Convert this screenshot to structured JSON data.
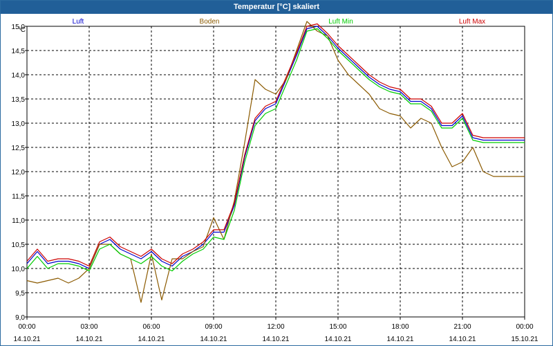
{
  "window": {
    "title": "Temperatur [°C] skaliert"
  },
  "chart_data": {
    "type": "line",
    "title": "Temperatur [°C] skaliert",
    "ylabel": "°C",
    "ylim": [
      9.0,
      15.0
    ],
    "yticks": [
      "9,0",
      "9,5",
      "10,0",
      "10,5",
      "11,0",
      "11,5",
      "12,0",
      "12,5",
      "13,0",
      "13,5",
      "14,0",
      "14,5",
      "15,0"
    ],
    "xlim": [
      0,
      24
    ],
    "xticks": [
      {
        "time": "00:00",
        "date": "14.10.21"
      },
      {
        "time": "03:00",
        "date": "14.10.21"
      },
      {
        "time": "06:00",
        "date": "14.10.21"
      },
      {
        "time": "09:00",
        "date": "14.10.21"
      },
      {
        "time": "12:00",
        "date": "14.10.21"
      },
      {
        "time": "15:00",
        "date": "14.10.21"
      },
      {
        "time": "18:00",
        "date": "14.10.21"
      },
      {
        "time": "21:00",
        "date": "14.10.21"
      },
      {
        "time": "00:00",
        "date": "15.10.21"
      }
    ],
    "grid": true,
    "legend_position": "top",
    "series": [
      {
        "name": "Luft",
        "color": "#0000cc",
        "x": [
          0,
          0.5,
          1,
          1.5,
          2,
          2.5,
          3,
          3.5,
          4,
          4.5,
          5,
          5.5,
          6,
          6.5,
          7,
          7.5,
          8,
          8.5,
          9,
          9.5,
          10,
          10.5,
          11,
          11.5,
          12,
          12.5,
          13,
          13.5,
          14,
          14.5,
          15,
          15.5,
          16,
          16.5,
          17,
          17.5,
          18,
          18.5,
          19,
          19.5,
          20,
          20.5,
          21,
          21.5,
          22,
          22.5,
          23,
          23.5,
          24
        ],
        "values": [
          10.1,
          10.35,
          10.1,
          10.15,
          10.15,
          10.1,
          10.0,
          10.5,
          10.6,
          10.4,
          10.3,
          10.2,
          10.35,
          10.15,
          10.05,
          10.25,
          10.35,
          10.5,
          10.75,
          10.75,
          11.3,
          12.3,
          13.05,
          13.3,
          13.4,
          13.9,
          14.4,
          14.95,
          15.0,
          14.8,
          14.55,
          14.35,
          14.15,
          13.95,
          13.8,
          13.7,
          13.65,
          13.45,
          13.45,
          13.3,
          12.95,
          12.95,
          13.15,
          12.7,
          12.65,
          12.65,
          12.65,
          12.65,
          12.65
        ]
      },
      {
        "name": "Boden",
        "color": "#8b5a00",
        "x": [
          0,
          0.5,
          1,
          1.5,
          2,
          2.5,
          3,
          3.5,
          4,
          4.5,
          5,
          5.5,
          6,
          6.5,
          7,
          7.5,
          8,
          8.5,
          9,
          9.5,
          10,
          10.5,
          11,
          11.5,
          12,
          12.5,
          13,
          13.5,
          14,
          14.5,
          15,
          15.5,
          16,
          16.5,
          17,
          17.5,
          18,
          18.5,
          19,
          19.5,
          20,
          20.5,
          21,
          21.5,
          22,
          22.5,
          23,
          23.5,
          24
        ],
        "values": [
          9.75,
          9.7,
          9.75,
          9.8,
          9.7,
          9.8,
          10.0,
          10.5,
          10.5,
          10.3,
          10.2,
          9.3,
          10.3,
          9.35,
          10.2,
          10.2,
          10.35,
          10.45,
          11.05,
          10.6,
          11.4,
          12.6,
          13.9,
          13.7,
          13.6,
          13.9,
          14.5,
          15.1,
          14.9,
          14.8,
          14.3,
          14.0,
          13.8,
          13.6,
          13.3,
          13.2,
          13.15,
          12.9,
          13.1,
          13.0,
          12.5,
          12.1,
          12.2,
          12.5,
          12.0,
          11.9,
          11.9,
          11.9,
          11.9
        ]
      },
      {
        "name": "Luft Min",
        "color": "#00cc00",
        "x": [
          0,
          0.5,
          1,
          1.5,
          2,
          2.5,
          3,
          3.5,
          4,
          4.5,
          5,
          5.5,
          6,
          6.5,
          7,
          7.5,
          8,
          8.5,
          9,
          9.5,
          10,
          10.5,
          11,
          11.5,
          12,
          12.5,
          13,
          13.5,
          14,
          14.5,
          15,
          15.5,
          16,
          16.5,
          17,
          17.5,
          18,
          18.5,
          19,
          19.5,
          20,
          20.5,
          21,
          21.5,
          22,
          22.5,
          23,
          23.5,
          24
        ],
        "values": [
          10.0,
          10.25,
          10.0,
          10.1,
          10.1,
          10.05,
          9.95,
          10.4,
          10.5,
          10.3,
          10.2,
          10.1,
          10.25,
          10.05,
          9.95,
          10.15,
          10.3,
          10.4,
          10.65,
          10.6,
          11.2,
          12.2,
          12.95,
          13.2,
          13.3,
          13.8,
          14.3,
          14.9,
          14.95,
          14.75,
          14.5,
          14.3,
          14.1,
          13.9,
          13.75,
          13.65,
          13.6,
          13.4,
          13.4,
          13.25,
          12.9,
          12.9,
          13.1,
          12.65,
          12.6,
          12.6,
          12.6,
          12.6,
          12.6
        ]
      },
      {
        "name": "Luft Max",
        "color": "#cc0000",
        "x": [
          0,
          0.5,
          1,
          1.5,
          2,
          2.5,
          3,
          3.5,
          4,
          4.5,
          5,
          5.5,
          6,
          6.5,
          7,
          7.5,
          8,
          8.5,
          9,
          9.5,
          10,
          10.5,
          11,
          11.5,
          12,
          12.5,
          13,
          13.5,
          14,
          14.5,
          15,
          15.5,
          16,
          16.5,
          17,
          17.5,
          18,
          18.5,
          19,
          19.5,
          20,
          20.5,
          21,
          21.5,
          22,
          22.5,
          23,
          23.5,
          24
        ],
        "values": [
          10.15,
          10.4,
          10.15,
          10.2,
          10.2,
          10.15,
          10.05,
          10.55,
          10.65,
          10.45,
          10.35,
          10.25,
          10.4,
          10.2,
          10.1,
          10.3,
          10.4,
          10.55,
          10.8,
          10.8,
          11.35,
          12.35,
          13.1,
          13.35,
          13.45,
          13.95,
          14.45,
          15.0,
          15.05,
          14.85,
          14.6,
          14.4,
          14.2,
          14.0,
          13.85,
          13.75,
          13.7,
          13.5,
          13.5,
          13.35,
          13.0,
          13.0,
          13.2,
          12.75,
          12.7,
          12.7,
          12.7,
          12.7,
          12.7
        ]
      }
    ]
  }
}
